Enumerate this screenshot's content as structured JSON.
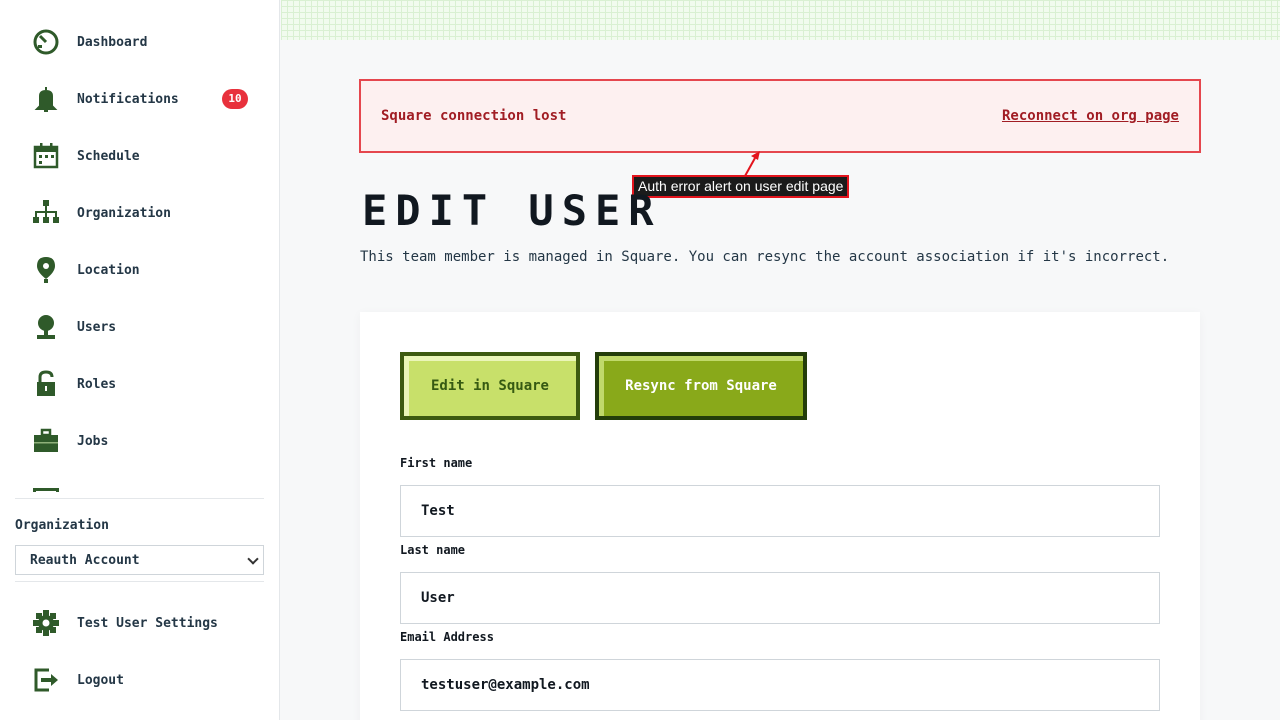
{
  "sidebar": {
    "items": [
      {
        "label": "Dashboard",
        "icon": "dashboard-gauge-icon"
      },
      {
        "label": "Notifications",
        "icon": "bell-icon",
        "badge": "10"
      },
      {
        "label": "Schedule",
        "icon": "calendar-icon"
      },
      {
        "label": "Organization",
        "icon": "org-chart-icon"
      },
      {
        "label": "Location",
        "icon": "map-pin-icon"
      },
      {
        "label": "Users",
        "icon": "user-icon"
      },
      {
        "label": "Roles",
        "icon": "unlock-icon"
      },
      {
        "label": "Jobs",
        "icon": "briefcase-icon"
      }
    ],
    "org_label": "Organization",
    "org_selected": "Reauth Account",
    "settings_label": "Test User Settings",
    "logout_label": "Logout"
  },
  "alert": {
    "message": "Square connection lost",
    "link": "Reconnect on org page"
  },
  "annotation": "Auth error alert on user edit page",
  "page": {
    "title": "Edit User",
    "description": "This team member is managed in Square. You can resync the account association if it's incorrect."
  },
  "actions": {
    "edit_label": "Edit in Square",
    "resync_label": "Resync from Square"
  },
  "form": {
    "first_name_label": "First name",
    "first_name_value": "Test",
    "last_name_label": "Last name",
    "last_name_value": "User",
    "email_label": "Email Address",
    "email_value": "testuser@example.com"
  },
  "colors": {
    "accent_dark_green": "#2f5a2a",
    "badge_red": "#e8313c",
    "alert_red": "#a11d24",
    "button_lime": "#c8e06a",
    "button_olive": "#89a91a"
  }
}
